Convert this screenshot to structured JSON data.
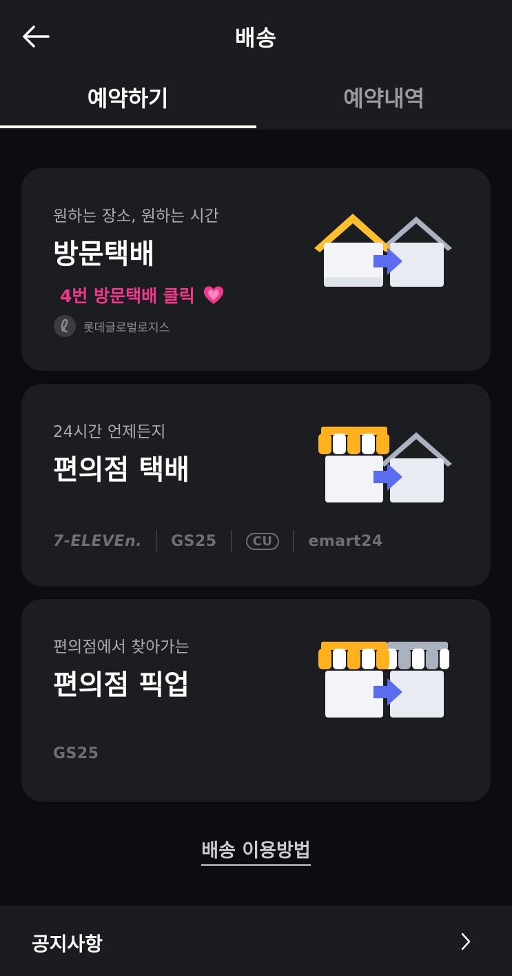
{
  "header": {
    "title": "배송",
    "back_icon": "arrow-left-icon"
  },
  "tabs": [
    {
      "label": "예약하기",
      "active": true
    },
    {
      "label": "예약내역",
      "active": false
    }
  ],
  "cards": [
    {
      "subtitle": "원하는 장소, 원하는 시간",
      "title": "방문택배",
      "promo": "4번 방문택배 클릭",
      "promo_icon": "heart-icon",
      "carrier": "롯데글로벌로지스",
      "carrier_icon": "lotte-logo-icon",
      "illustration": "house-to-house-icon"
    },
    {
      "subtitle": "24시간 언제든지",
      "title": "편의점 택배",
      "brands": [
        "7-ELEVEn.",
        "GS25",
        "CU",
        "emart24"
      ],
      "illustration": "store-to-house-icon"
    },
    {
      "subtitle": "편의점에서 찾아가는",
      "title": "편의점 픽업",
      "brands": [
        "GS25"
      ],
      "illustration": "store-to-store-icon"
    }
  ],
  "guide_link": "배송 이용방법",
  "notice": {
    "label": "공지사항",
    "icon": "chevron-right-icon"
  },
  "colors": {
    "background": "#0c0d10",
    "surface": "#1c1d21",
    "promo": "#f0388e",
    "roof_yellow": "#ffc02e",
    "arrow_blue": "#5a6cf0"
  }
}
